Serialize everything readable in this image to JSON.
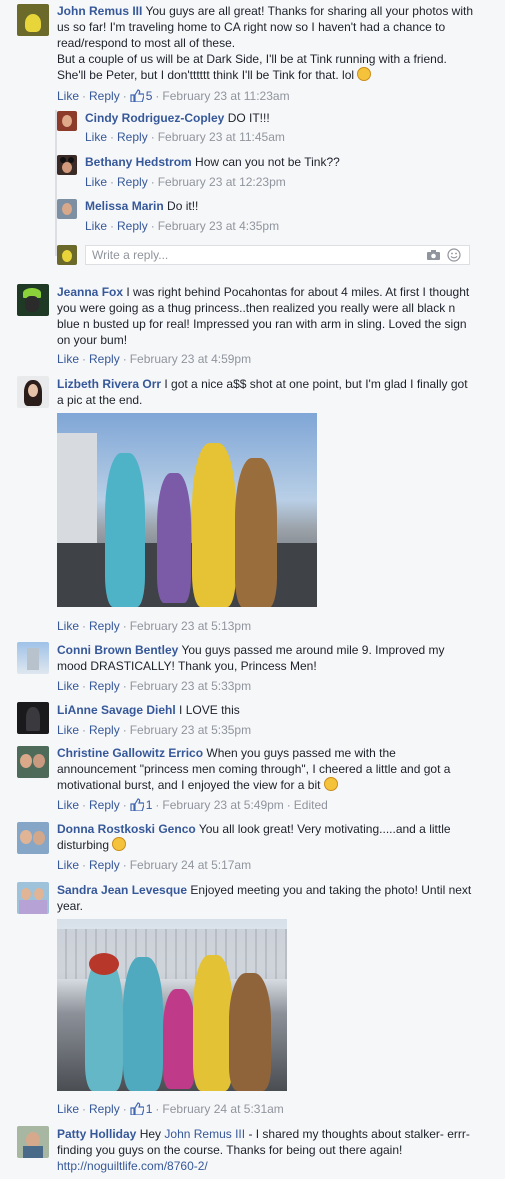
{
  "comments": [
    {
      "name": "John Remus III",
      "text": "You guys are all great! Thanks for sharing all your photos with us so far! I'm traveling home to CA right now so I haven't had a chance to read/respond to most all of these.",
      "text2": "But a couple of us will be at Dark Side, I'll be at Tink running with a friend. She'll be Peter, but I don'tttttt think I'll be Tink for that. lol",
      "like": "Like",
      "reply": "Reply",
      "likes": "5",
      "time": "February 23 at 11:23am"
    },
    {
      "name": "Jeanna Fox",
      "text": "I was right behind Pocahontas for about 4 miles. At first I thought you were going as a thug princess..then realized you really were all black n blue n busted up for real! Impressed you ran with arm in sling. Loved the sign on your bum!",
      "like": "Like",
      "reply": "Reply",
      "time": "February 23 at 4:59pm"
    },
    {
      "name": "Lizbeth Rivera Orr",
      "text": "I got a nice a$$ shot at one point, but I'm glad I finally got a pic at the end.",
      "like": "Like",
      "reply": "Reply",
      "time": "February 23 at 5:13pm"
    },
    {
      "name": "Conni Brown Bentley",
      "text": "You guys passed me around mile 9. Improved my mood DRASTICALLY! Thank you, Princess Men!",
      "like": "Like",
      "reply": "Reply",
      "time": "February 23 at 5:33pm"
    },
    {
      "name": "LiAnne Savage Diehl",
      "text": "I LOVE this",
      "like": "Like",
      "reply": "Reply",
      "time": "February 23 at 5:35pm"
    },
    {
      "name": "Christine Gallowitz Errico",
      "text": "When you guys passed me with the announcement \"princess men coming through\", I cheered a little and got a motivational burst, and I enjoyed the view for a bit",
      "like": "Like",
      "reply": "Reply",
      "likes": "1",
      "time": "February 23 at 5:49pm",
      "edited": "Edited"
    },
    {
      "name": "Donna Rostkoski Genco",
      "text": "You all look great! Very motivating.....and a little disturbing",
      "like": "Like",
      "reply": "Reply",
      "time": "February 24 at 5:17am"
    },
    {
      "name": "Sandra Jean Levesque",
      "text": "Enjoyed meeting you and taking the photo! Until next year.",
      "like": "Like",
      "reply": "Reply",
      "likes": "1",
      "time": "February 24 at 5:31am"
    },
    {
      "name": "Patty Holliday",
      "pre": "Hey",
      "mention": "John Remus III",
      "text": "- I shared my thoughts about stalker- errr- finding you guys on the course. Thanks for being out there again!",
      "url": "http://noguiltlife.com/8760-2/"
    }
  ],
  "replies": [
    {
      "name": "Cindy Rodriguez-Copley",
      "text": "DO IT!!!",
      "like": "Like",
      "reply": "Reply",
      "time": "February 23 at 11:45am"
    },
    {
      "name": "Bethany Hedstrom",
      "text": "How can you not be Tink??",
      "like": "Like",
      "reply": "Reply",
      "time": "February 23 at 12:23pm"
    },
    {
      "name": "Melissa Marin",
      "text": "Do it!!",
      "like": "Like",
      "reply": "Reply",
      "time": "February 23 at 4:35pm"
    }
  ],
  "reply_box": {
    "placeholder": "Write a reply..."
  },
  "dot": "·"
}
